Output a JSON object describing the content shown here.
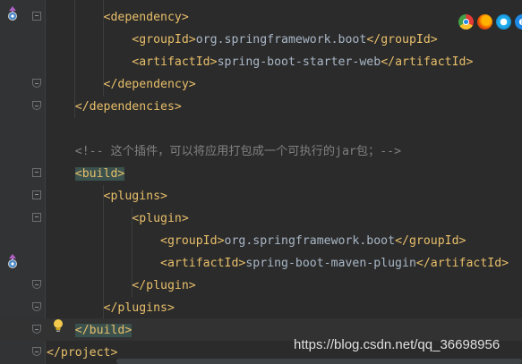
{
  "editor": {
    "lines": [
      {
        "indent": "        ",
        "parts": [
          {
            "t": "tag",
            "v": "<dependency>"
          }
        ]
      },
      {
        "indent": "            ",
        "parts": [
          {
            "t": "tag",
            "v": "<groupId>"
          },
          {
            "t": "text",
            "v": "org.springframework.boot"
          },
          {
            "t": "tag",
            "v": "</groupId>"
          }
        ]
      },
      {
        "indent": "            ",
        "parts": [
          {
            "t": "tag",
            "v": "<artifactId>"
          },
          {
            "t": "text",
            "v": "spring-boot-starter-web"
          },
          {
            "t": "tag",
            "v": "</artifactId>"
          }
        ]
      },
      {
        "indent": "        ",
        "parts": [
          {
            "t": "tag",
            "v": "</dependency>"
          }
        ]
      },
      {
        "indent": "    ",
        "parts": [
          {
            "t": "tag",
            "v": "</dependencies>"
          }
        ]
      },
      {
        "indent": "",
        "parts": []
      },
      {
        "indent": "    ",
        "parts": [
          {
            "t": "comment",
            "v": "<!-- 这个插件，可以将应用打包成一个可执行的jar包；-->"
          }
        ]
      },
      {
        "indent": "    ",
        "parts": [
          {
            "t": "tagmatch",
            "v": "<build>"
          }
        ]
      },
      {
        "indent": "        ",
        "parts": [
          {
            "t": "tag",
            "v": "<plugins>"
          }
        ]
      },
      {
        "indent": "            ",
        "parts": [
          {
            "t": "tag",
            "v": "<plugin>"
          }
        ]
      },
      {
        "indent": "                ",
        "parts": [
          {
            "t": "tag",
            "v": "<groupId>"
          },
          {
            "t": "text",
            "v": "org.springframework.boot"
          },
          {
            "t": "tag",
            "v": "</groupId>"
          }
        ]
      },
      {
        "indent": "                ",
        "parts": [
          {
            "t": "tag",
            "v": "<artifactId>"
          },
          {
            "t": "text",
            "v": "spring-boot-maven-plugin"
          },
          {
            "t": "tag",
            "v": "</artifactId>"
          }
        ]
      },
      {
        "indent": "            ",
        "parts": [
          {
            "t": "tag",
            "v": "</plugin>"
          }
        ]
      },
      {
        "indent": "        ",
        "parts": [
          {
            "t": "tag",
            "v": "</plugins>"
          }
        ]
      },
      {
        "indent": "    ",
        "parts": [
          {
            "t": "tagmatch",
            "v": "</build>"
          }
        ]
      },
      {
        "indent": "",
        "parts": [
          {
            "t": "tag",
            "v": "</project>"
          }
        ]
      }
    ]
  },
  "browser_icons": [
    "chrome-icon",
    "firefox-icon",
    "safari-icon",
    "ie-icon"
  ],
  "ie_letter": "e",
  "watermark": "https://blog.csdn.net/qq_36698956",
  "colors": {
    "background": "#2b2b2b",
    "tag": "#e8bf6a",
    "text": "#a9b7c6",
    "comment": "#808080",
    "tag_match_bg": "#3b514d"
  }
}
